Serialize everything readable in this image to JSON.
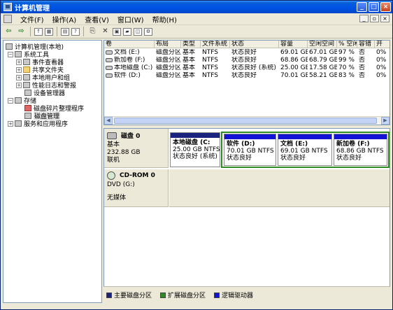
{
  "window": {
    "title": "计算机管理"
  },
  "menu": [
    "文件(F)",
    "操作(A)",
    "查看(V)",
    "窗口(W)",
    "帮助(H)"
  ],
  "mdi_controls": [
    "_",
    "▫",
    "×"
  ],
  "window_controls": [
    "_",
    "□",
    "×"
  ],
  "toolbar_icons": [
    "back-arrow-icon",
    "forward-arrow-icon",
    "up-folder-icon",
    "console-tree-icon",
    "properties-icon",
    "help-icon",
    "refresh-icon",
    "delete-icon",
    "export-icon",
    "open-icon",
    "view-icon",
    "settings-icon"
  ],
  "tree": {
    "root": "计算机管理(本地)",
    "system_tools": "系统工具",
    "event_viewer": "事件查看器",
    "shared_folders": "共享文件夹",
    "local_users": "本地用户和组",
    "perf_logs": "性能日志和警报",
    "device_manager": "设备管理器",
    "storage": "存储",
    "defrag": "磁盘碎片整理程序",
    "disk_mgmt": "磁盘管理",
    "services_apps": "服务和应用程序"
  },
  "volume_list": {
    "headers": [
      "卷",
      "布局",
      "类型",
      "文件系统",
      "状态",
      "容量",
      "空闲空间",
      "% 空闲",
      "容错",
      "开"
    ],
    "rows": [
      [
        "文档 (E:)",
        "磁盘分区",
        "基本",
        "NTFS",
        "状态良好",
        "69.01 GB",
        "67.01 GB",
        "97 %",
        "否",
        "0%"
      ],
      [
        "新加卷 (F:)",
        "磁盘分区",
        "基本",
        "NTFS",
        "状态良好",
        "68.86 GB",
        "68.79 GB",
        "99 %",
        "否",
        "0%"
      ],
      [
        "本地磁盘 (C:)",
        "磁盘分区",
        "基本",
        "NTFS",
        "状态良好 (系统)",
        "25.00 GB",
        "17.58 GB",
        "70 %",
        "否",
        "0%"
      ],
      [
        "软件 (D:)",
        "磁盘分区",
        "基本",
        "NTFS",
        "状态良好",
        "70.01 GB",
        "58.21 GB",
        "83 %",
        "否",
        "0%"
      ]
    ]
  },
  "disk0": {
    "name": "磁盘 0",
    "type": "基本",
    "size": "232.88 GB",
    "status": "联机",
    "partitions": [
      {
        "name": "本地磁盘 (C:",
        "size": "25.00 GB NTFS",
        "status": "状态良好 (系统)",
        "kind": "primary"
      },
      {
        "name": "软件 (D:)",
        "size": "70.01 GB NTFS",
        "status": "状态良好",
        "kind": "logical"
      },
      {
        "name": "文档 (E:)",
        "size": "69.01 GB NTFS",
        "status": "状态良好",
        "kind": "logical"
      },
      {
        "name": "新加卷 (F:)",
        "size": "68.86 GB NTFS",
        "status": "状态良好",
        "kind": "logical"
      }
    ]
  },
  "cdrom0": {
    "name": "CD-ROM 0",
    "type": "DVD (G:)",
    "status": "无媒体"
  },
  "legend": [
    {
      "label": "主要磁盘分区",
      "color": "#1a237e"
    },
    {
      "label": "扩展磁盘分区",
      "color": "#2e8b23"
    },
    {
      "label": "逻辑驱动器",
      "color": "#1313d6"
    }
  ]
}
